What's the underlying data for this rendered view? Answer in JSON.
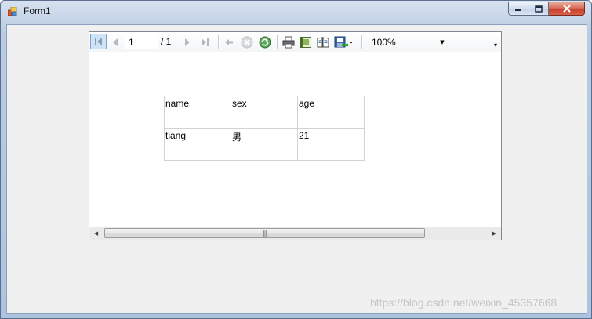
{
  "window": {
    "title": "Form1"
  },
  "toolbar": {
    "page_current": "1",
    "page_total_text": "/ 1",
    "zoom": "100%"
  },
  "report": {
    "headers": [
      "name",
      "sex",
      "age"
    ],
    "rows": [
      [
        "tiang",
        "男",
        "21"
      ]
    ]
  },
  "watermark": "https://blog.csdn.net/weixin_45357668",
  "icons": [
    "first-page-icon",
    "prev-page-icon",
    "next-page-icon",
    "last-page-icon",
    "back-icon",
    "stop-icon",
    "refresh-icon",
    "print-icon",
    "print-layout-icon",
    "page-setup-icon",
    "export-icon",
    "zoom-dropdown-arrow",
    "toolbar-overflow-icon",
    "scroll-left-icon",
    "scroll-right-icon"
  ],
  "colors": {
    "titlebar": "#c3d3e6",
    "close_button": "#c7412b",
    "first_button_highlight": "#cfe3f7"
  }
}
